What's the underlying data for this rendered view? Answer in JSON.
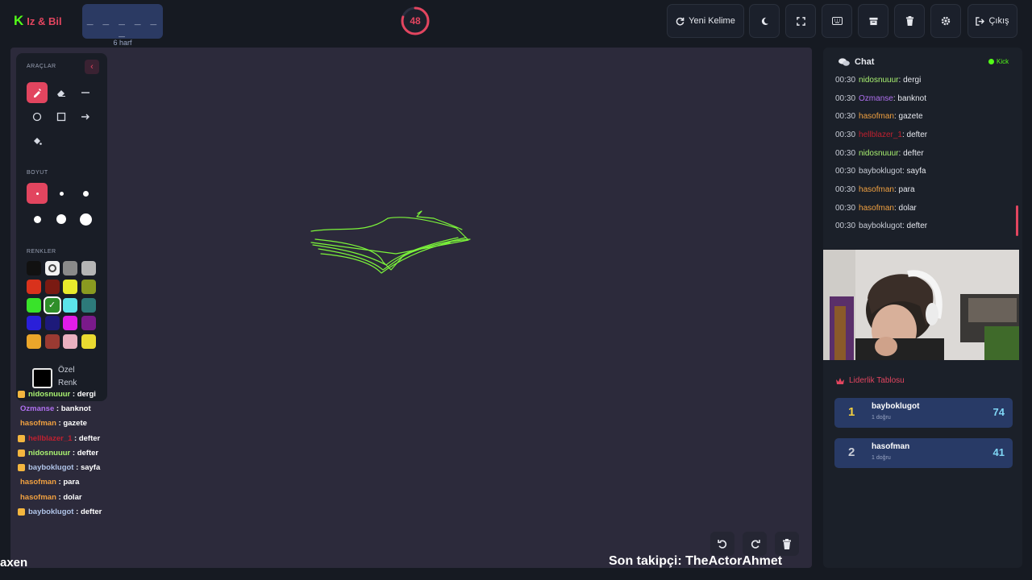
{
  "header": {
    "logo_letter": "K",
    "logo_title": "Iz & Bil",
    "word_mask": "_ _ _ _ _ _",
    "word_hint": "6 harf",
    "timer": "48",
    "timer_progress": 0.8,
    "new_word_label": "Yeni Kelime",
    "exit_label": "Çıkış"
  },
  "tools": {
    "title": "ARAÇLAR",
    "size_title": "BOYUT",
    "colors_title": "RENKLER",
    "custom_color_label": "Özel Renk",
    "palette": [
      "#111111",
      "#f2f2f2",
      "#8a8a8a",
      "#b5b5b5",
      "#d9321c",
      "#7a1a12",
      "#e8ea2c",
      "#8a9a20",
      "#39e32a",
      "#2f8f2a",
      "#5ce3ea",
      "#2d7a7a",
      "#2a1fd9",
      "#1d1a7a",
      "#e21ce8",
      "#7a1a8a",
      "#eba62a",
      "#9a3a32",
      "#eab0c0",
      "#eada30"
    ],
    "selected_color": "#2f8f2a"
  },
  "overlay_chat": [
    {
      "user": "nidosnuuur",
      "color": "#a8f070",
      "text": "dergi",
      "badge": true
    },
    {
      "user": "Ozmanse",
      "color": "#b070f0",
      "text": "banknot",
      "badge": false
    },
    {
      "user": "hasofman",
      "color": "#f0a040",
      "text": "gazete",
      "badge": false
    },
    {
      "user": "hellblazer_1",
      "color": "#c02030",
      "text": "defter",
      "badge": true
    },
    {
      "user": "nidosnuuur",
      "color": "#a8f070",
      "text": "defter",
      "badge": true
    },
    {
      "user": "bayboklugot",
      "color": "#b0c4e8",
      "text": "sayfa",
      "badge": true
    },
    {
      "user": "hasofman",
      "color": "#f0a040",
      "text": "para",
      "badge": false
    },
    {
      "user": "hasofman",
      "color": "#f0a040",
      "text": "dolar",
      "badge": false
    },
    {
      "user": "bayboklugot",
      "color": "#b0c4e8",
      "text": "defter",
      "badge": true
    }
  ],
  "overlay_bottom_left": "axen",
  "overlay_follower": "Son takipçi: TheActorAhmet",
  "chat": {
    "title": "Chat",
    "platform": "Kick",
    "messages": [
      {
        "time": "00:30",
        "user": "nidosnuuur",
        "color": "#a8f070",
        "text": "dergi"
      },
      {
        "time": "00:30",
        "user": "Ozmanse",
        "color": "#b070f0",
        "text": "banknot"
      },
      {
        "time": "00:30",
        "user": "hasofman",
        "color": "#f0a040",
        "text": "gazete"
      },
      {
        "time": "00:30",
        "user": "hellblazer_1",
        "color": "#c02030",
        "text": "defter"
      },
      {
        "time": "00:30",
        "user": "nidosnuuur",
        "color": "#a8f070",
        "text": "defter"
      },
      {
        "time": "00:30",
        "user": "bayboklugot",
        "color": "#c8ccd6",
        "text": "sayfa"
      },
      {
        "time": "00:30",
        "user": "hasofman",
        "color": "#f0a040",
        "text": "para"
      },
      {
        "time": "00:30",
        "user": "hasofman",
        "color": "#f0a040",
        "text": "dolar"
      },
      {
        "time": "00:30",
        "user": "bayboklugot",
        "color": "#c8ccd6",
        "text": "defter"
      }
    ]
  },
  "leaderboard": {
    "title": "Liderlik Tablosu",
    "entries": [
      {
        "rank": "1",
        "name": "bayboklugot",
        "sub": "1 doğru",
        "score": "74",
        "rank_color": "#f4d03f"
      },
      {
        "rank": "2",
        "name": "hasofman",
        "sub": "1 doğru",
        "score": "41",
        "rank_color": "#c8ccd6"
      }
    ]
  },
  "colors": {
    "accent": "#e2455f",
    "kick_green": "#53fc18",
    "stroke": "#7cf53a"
  }
}
